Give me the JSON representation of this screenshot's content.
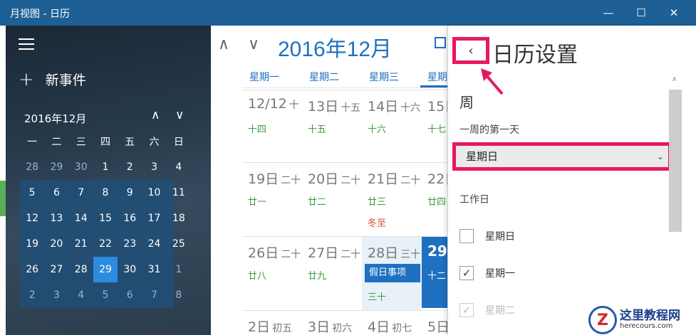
{
  "window": {
    "title": "月视图 - 日历",
    "minimize": "—",
    "maximize": "☐",
    "close": "✕"
  },
  "sidebar": {
    "menu_icon": "hamburger-icon",
    "new_event_plus": "+",
    "new_event_label": "新事件",
    "mini_month_title": "2016年12月",
    "mini_up": "∧",
    "mini_down": "∨",
    "weekdays": [
      "一",
      "二",
      "三",
      "四",
      "五",
      "六",
      "日"
    ],
    "weeks": [
      [
        "28",
        "29",
        "30",
        "1",
        "2",
        "3",
        "4"
      ],
      [
        "5",
        "6",
        "7",
        "8",
        "9",
        "10",
        "11"
      ],
      [
        "12",
        "13",
        "14",
        "15",
        "16",
        "17",
        "18"
      ],
      [
        "19",
        "20",
        "21",
        "22",
        "23",
        "24",
        "25"
      ],
      [
        "26",
        "27",
        "28",
        "29",
        "30",
        "31",
        "1"
      ],
      [
        "2",
        "3",
        "4",
        "5",
        "6",
        "7",
        "8"
      ]
    ],
    "today": "29"
  },
  "main": {
    "up_icon": "∧",
    "down_icon": "∨",
    "month_title": "2016年12月",
    "weekday_headers": [
      "星期一",
      "星期二",
      "星期三",
      "星期"
    ],
    "rows": [
      {
        "days": [
          {
            "num": "12/12",
            "suffix": "十",
            "lunar": "十四"
          },
          {
            "num": "13日",
            "suffix": "十五",
            "lunar": "十五"
          },
          {
            "num": "14日",
            "suffix": "十六",
            "lunar": "十六"
          },
          {
            "num": "15日",
            "suffix": "",
            "lunar": "十七"
          }
        ]
      },
      {
        "days": [
          {
            "num": "19日",
            "suffix": "二十",
            "lunar": "廿一"
          },
          {
            "num": "20日",
            "suffix": "二十",
            "lunar": "廿二"
          },
          {
            "num": "21日",
            "suffix": "二十",
            "lunar": "廿三",
            "term": "冬至"
          },
          {
            "num": "22日",
            "suffix": "",
            "lunar": "廿四"
          }
        ]
      },
      {
        "days": [
          {
            "num": "26日",
            "suffix": "二十",
            "lunar": "廿八"
          },
          {
            "num": "27日",
            "suffix": "二十",
            "lunar": "廿九"
          },
          {
            "num": "28日",
            "suffix": "三十",
            "event": "假日事项",
            "lunar": "三十"
          },
          {
            "num": "29",
            "lunar": "十二"
          }
        ]
      },
      {
        "days": [
          {
            "num": "2日",
            "suffix": "初五"
          },
          {
            "num": "3日",
            "suffix": "初六"
          },
          {
            "num": "4日",
            "suffix": "初七"
          },
          {
            "num": "5日",
            "suffix": ""
          }
        ]
      }
    ]
  },
  "settings": {
    "back_icon": "‹",
    "title": "日历设置",
    "section_week": "周",
    "first_day_label": "一周的第一天",
    "first_day_value": "星期日",
    "dropdown_chevron": "⌄",
    "workdays_label": "工作日",
    "workdays": [
      {
        "label": "星期日",
        "checked": false,
        "check_mark": ""
      },
      {
        "label": "星期一",
        "checked": true,
        "check_mark": "✓"
      },
      {
        "label": "星期二",
        "checked": true,
        "check_mark": "✓"
      }
    ],
    "scroll_up": "∧"
  },
  "watermark": {
    "logo_letter": "Z",
    "main_text": "这里教程网",
    "sub_text": "herecours.com"
  },
  "colors": {
    "accent": "#1e70c1",
    "titlebar": "#1e5f95",
    "highlight_frame": "#e8195a",
    "lunar_green": "#3c9a3c",
    "solar_term_red": "#e04a2a"
  }
}
